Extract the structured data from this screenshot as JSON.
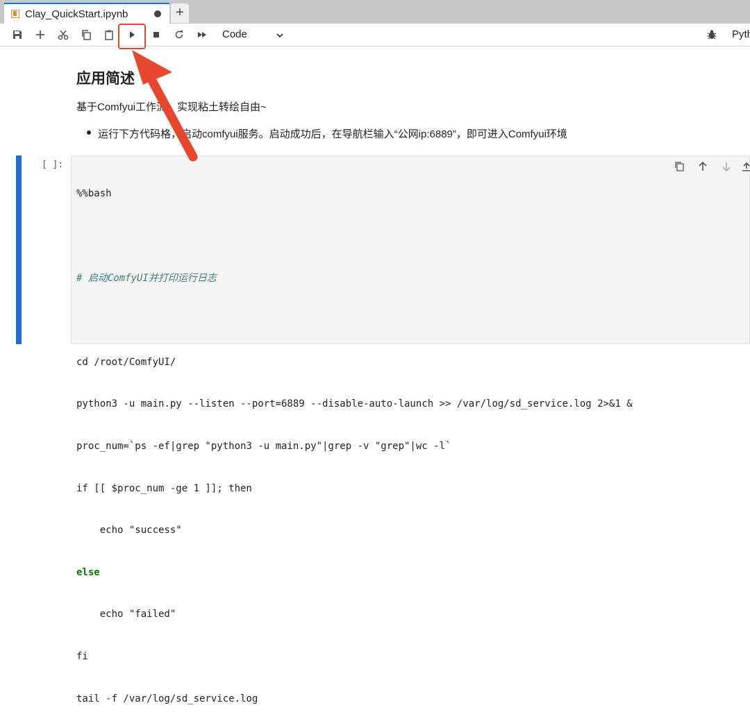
{
  "tab": {
    "title": "Clay_QuickStart.ipynb",
    "new_tab_label": "+"
  },
  "toolbar": {
    "cell_type": "Code",
    "kernel": "Python",
    "icons": [
      "save-icon",
      "add-icon",
      "cut-icon",
      "copy-icon",
      "paste-icon",
      "run-icon",
      "stop-icon",
      "restart-icon",
      "fast-forward-icon"
    ]
  },
  "markdown": {
    "heading": "应用简述",
    "paragraph": "基于Comfyui工作流，实现粘土转绘自由~",
    "list_item": "运行下方代码格，启动comfyui服务。启动成功后，在导航栏输入“公网ip:6889”，即可进入Comfyui环境"
  },
  "cell": {
    "prompt": "[ ]:",
    "code_lines": [
      "%%bash",
      "",
      "# 启动ComfyUI并打印运行日志",
      "",
      "cd /root/ComfyUI/",
      "python3 -u main.py --listen --port=6889 --disable-auto-launch >> /var/log/sd_service.log 2>&1 &",
      "proc_num=`ps -ef|grep \"python3 -u main.py\"|grep -v \"grep\"|wc -l`",
      "if [[ $proc_num -ge 1 ]]; then",
      "    echo \"success\"",
      "else",
      "    echo \"failed\"",
      "fi",
      "tail -f /var/log/sd_service.log"
    ]
  },
  "colors": {
    "accent": "#1e6fd6",
    "highlight": "#e0442b",
    "tab_icon": "#e58c26"
  }
}
